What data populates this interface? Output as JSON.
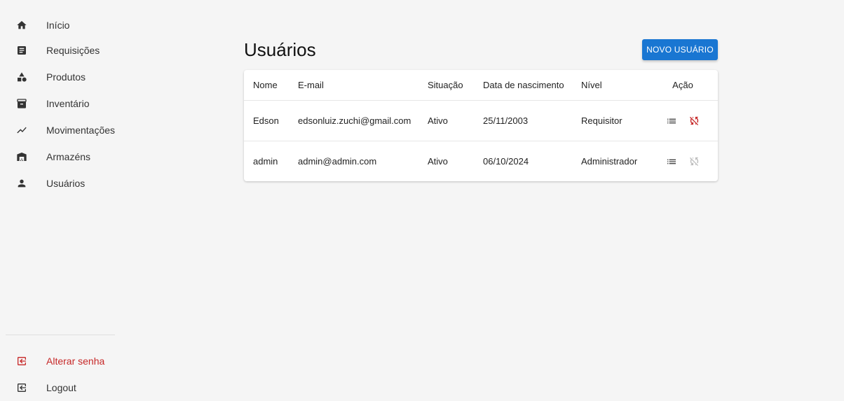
{
  "sidebar": {
    "items": [
      {
        "label": "Início",
        "icon": "home-icon"
      },
      {
        "label": "Requisições",
        "icon": "document-icon"
      },
      {
        "label": "Produtos",
        "icon": "category-icon"
      },
      {
        "label": "Inventário",
        "icon": "archive-box-icon"
      },
      {
        "label": "Movimentações",
        "icon": "trending-icon"
      },
      {
        "label": "Armazéns",
        "icon": "warehouse-icon"
      },
      {
        "label": "Usuários",
        "icon": "person-icon"
      }
    ],
    "bottom": [
      {
        "label": "Alterar senha",
        "icon": "logout-icon",
        "color": "#c62828"
      },
      {
        "label": "Logout",
        "icon": "logout-icon"
      }
    ]
  },
  "main": {
    "title": "Usuários",
    "new_button_label": "NOVO USUÁRIO",
    "table": {
      "headers": [
        "Nome",
        "E-mail",
        "Situação",
        "Data de nascimento",
        "Nível",
        "Ação"
      ],
      "rows": [
        {
          "nome": "Edson",
          "email": "edsonluiz.zuchi@gmail.com",
          "situacao": "Ativo",
          "nascimento": "25/11/2003",
          "nivel": "Requisitor",
          "toggle_enabled": true
        },
        {
          "nome": "admin",
          "email": "admin@admin.com",
          "situacao": "Ativo",
          "nascimento": "06/10/2024",
          "nivel": "Administrador",
          "toggle_enabled": false
        }
      ]
    }
  },
  "colors": {
    "primary": "#1976d2",
    "danger": "#c62828",
    "disabled": "#bdbdbd"
  }
}
